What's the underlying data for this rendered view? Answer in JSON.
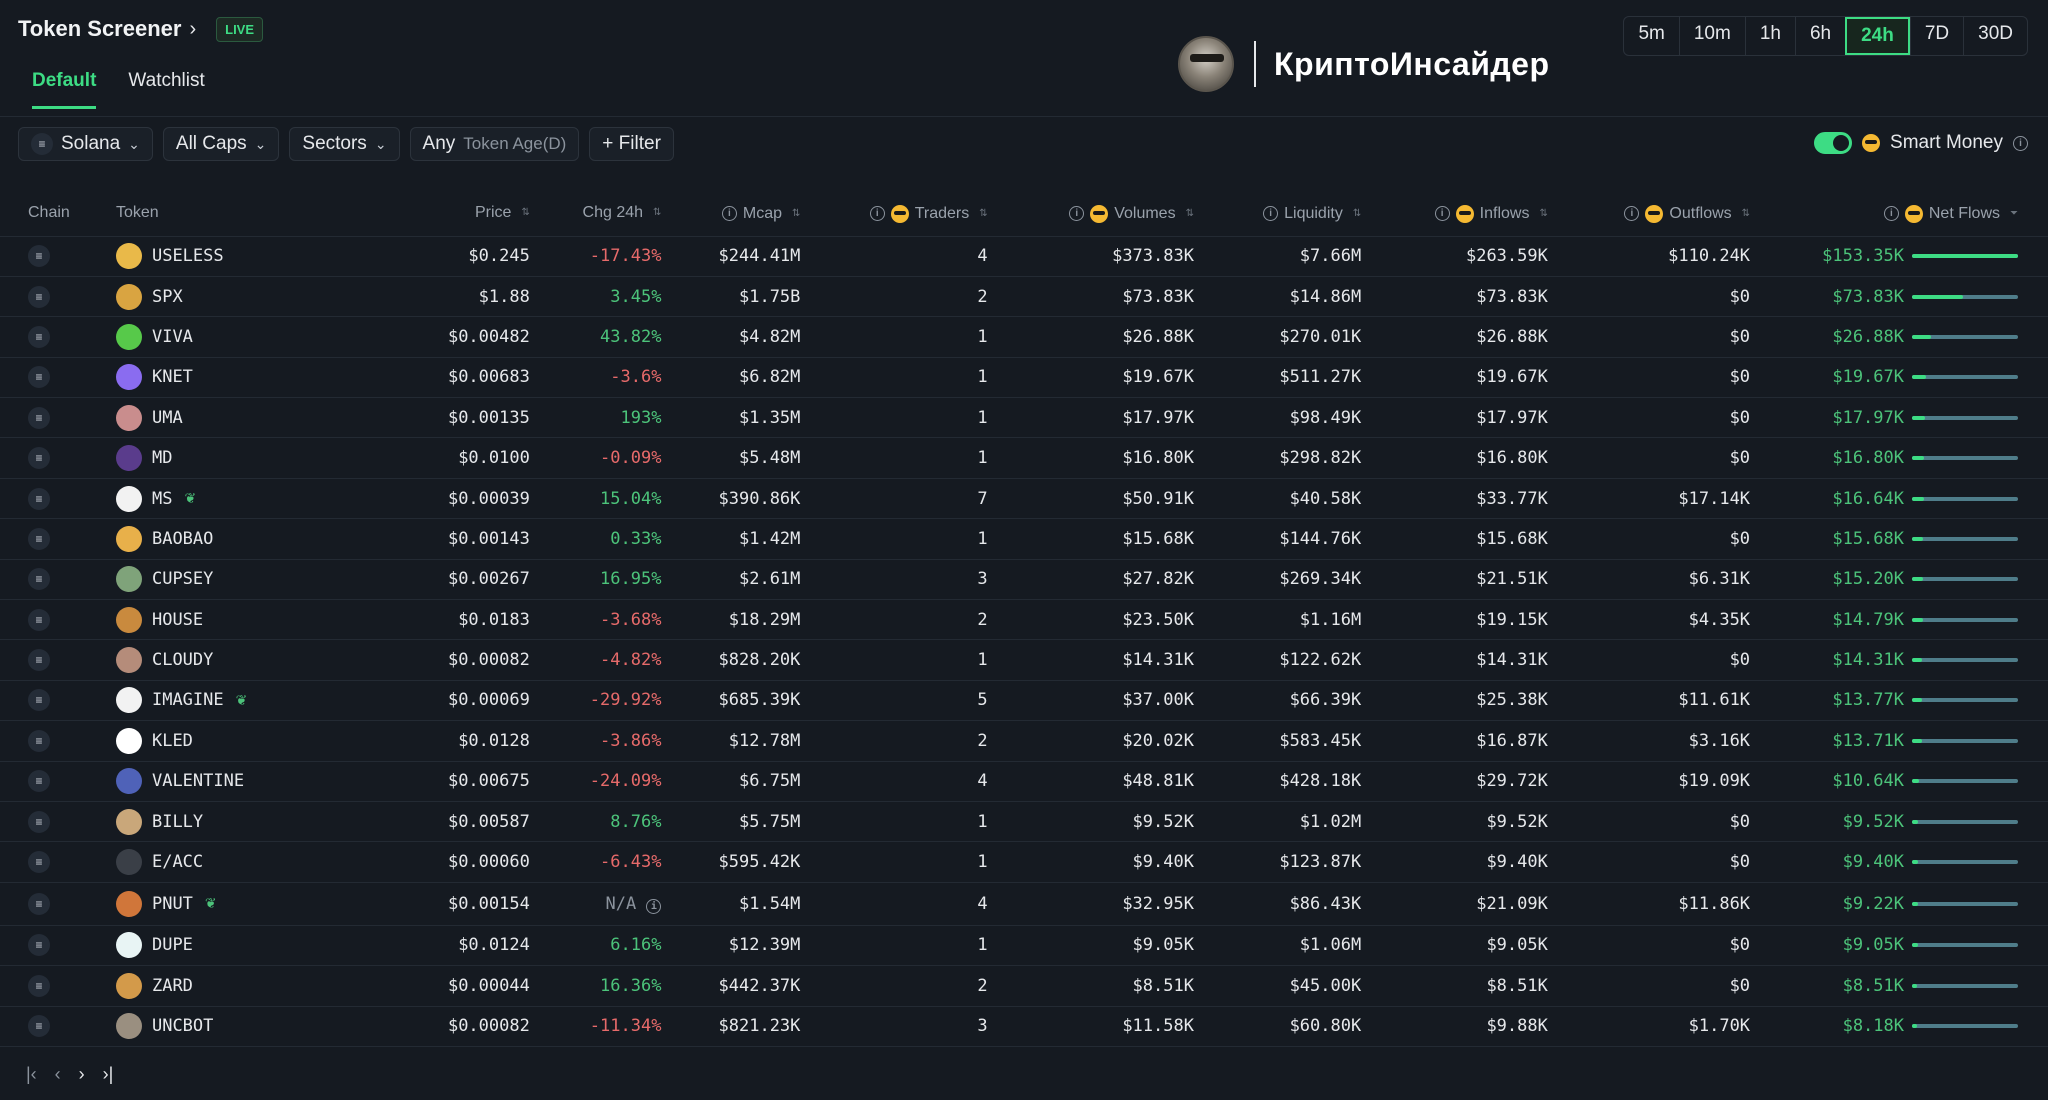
{
  "header": {
    "title": "Token Screener",
    "live_badge": "LIVE",
    "tabs": [
      "Default",
      "Watchlist"
    ],
    "brand": "КриптоИнсайдер"
  },
  "timeframes": [
    "5m",
    "10m",
    "1h",
    "6h",
    "24h",
    "7D",
    "30D"
  ],
  "active_timeframe": "24h",
  "filters": {
    "chain": "Solana",
    "caps": "All Caps",
    "sectors": "Sectors",
    "age_value": "Any",
    "age_label": "Token Age(D)",
    "filter": "+ Filter"
  },
  "smart_money": {
    "label": "Smart Money",
    "enabled": true
  },
  "columns": {
    "chain": "Chain",
    "token": "Token",
    "price": "Price",
    "chg": "Chg 24h",
    "mcap": "Mcap",
    "traders": "Traders",
    "volumes": "Volumes",
    "liquidity": "Liquidity",
    "inflows": "Inflows",
    "outflows": "Outflows",
    "net": "Net Flows"
  },
  "rows": [
    {
      "token": "USELESS",
      "price": "$0.245",
      "chg": "-17.43%",
      "mcap": "$244.41M",
      "traders": "4",
      "volumes": "$373.83K",
      "liquidity": "$7.66M",
      "inflows": "$263.59K",
      "outflows": "$110.24K",
      "net": "$153.35K",
      "net_frac": 1.0,
      "icon_color": "#e9b949",
      "sprout": false
    },
    {
      "token": "SPX",
      "price": "$1.88",
      "chg": "3.45%",
      "mcap": "$1.75B",
      "traders": "2",
      "volumes": "$73.83K",
      "liquidity": "$14.86M",
      "inflows": "$73.83K",
      "outflows": "$0",
      "net": "$73.83K",
      "net_frac": 0.48,
      "icon_color": "#d9a441",
      "sprout": false
    },
    {
      "token": "VIVA",
      "price": "$0.00482",
      "chg": "43.82%",
      "mcap": "$4.82M",
      "traders": "1",
      "volumes": "$26.88K",
      "liquidity": "$270.01K",
      "inflows": "$26.88K",
      "outflows": "$0",
      "net": "$26.88K",
      "net_frac": 0.18,
      "icon_color": "#57c94a",
      "sprout": false
    },
    {
      "token": "KNET",
      "price": "$0.00683",
      "chg": "-3.6%",
      "mcap": "$6.82M",
      "traders": "1",
      "volumes": "$19.67K",
      "liquidity": "$511.27K",
      "inflows": "$19.67K",
      "outflows": "$0",
      "net": "$19.67K",
      "net_frac": 0.13,
      "icon_color": "#8a6cf0",
      "sprout": false
    },
    {
      "token": "UMA",
      "price": "$0.00135",
      "chg": "193%",
      "mcap": "$1.35M",
      "traders": "1",
      "volumes": "$17.97K",
      "liquidity": "$98.49K",
      "inflows": "$17.97K",
      "outflows": "$0",
      "net": "$17.97K",
      "net_frac": 0.12,
      "icon_color": "#c98d8d",
      "sprout": false
    },
    {
      "token": "MD",
      "price": "$0.0100",
      "chg": "-0.09%",
      "mcap": "$5.48M",
      "traders": "1",
      "volumes": "$16.80K",
      "liquidity": "$298.82K",
      "inflows": "$16.80K",
      "outflows": "$0",
      "net": "$16.80K",
      "net_frac": 0.11,
      "icon_color": "#5a3c8c",
      "sprout": false
    },
    {
      "token": "MS",
      "price": "$0.00039",
      "chg": "15.04%",
      "mcap": "$390.86K",
      "traders": "7",
      "volumes": "$50.91K",
      "liquidity": "$40.58K",
      "inflows": "$33.77K",
      "outflows": "$17.14K",
      "net": "$16.64K",
      "net_frac": 0.11,
      "icon_color": "#f2f2f2",
      "sprout": true
    },
    {
      "token": "BAOBAO",
      "price": "$0.00143",
      "chg": "0.33%",
      "mcap": "$1.42M",
      "traders": "1",
      "volumes": "$15.68K",
      "liquidity": "$144.76K",
      "inflows": "$15.68K",
      "outflows": "$0",
      "net": "$15.68K",
      "net_frac": 0.1,
      "icon_color": "#e8b04a",
      "sprout": false
    },
    {
      "token": "CUPSEY",
      "price": "$0.00267",
      "chg": "16.95%",
      "mcap": "$2.61M",
      "traders": "3",
      "volumes": "$27.82K",
      "liquidity": "$269.34K",
      "inflows": "$21.51K",
      "outflows": "$6.31K",
      "net": "$15.20K",
      "net_frac": 0.1,
      "icon_color": "#7fa37a",
      "sprout": false
    },
    {
      "token": "HOUSE",
      "price": "$0.0183",
      "chg": "-3.68%",
      "mcap": "$18.29M",
      "traders": "2",
      "volumes": "$23.50K",
      "liquidity": "$1.16M",
      "inflows": "$19.15K",
      "outflows": "$4.35K",
      "net": "$14.79K",
      "net_frac": 0.1,
      "icon_color": "#c98a3e",
      "sprout": false
    },
    {
      "token": "CLOUDY",
      "price": "$0.00082",
      "chg": "-4.82%",
      "mcap": "$828.20K",
      "traders": "1",
      "volumes": "$14.31K",
      "liquidity": "$122.62K",
      "inflows": "$14.31K",
      "outflows": "$0",
      "net": "$14.31K",
      "net_frac": 0.09,
      "icon_color": "#b58c7a",
      "sprout": false
    },
    {
      "token": "IMAGINE",
      "price": "$0.00069",
      "chg": "-29.92%",
      "mcap": "$685.39K",
      "traders": "5",
      "volumes": "$37.00K",
      "liquidity": "$66.39K",
      "inflows": "$25.38K",
      "outflows": "$11.61K",
      "net": "$13.77K",
      "net_frac": 0.09,
      "icon_color": "#f2f2f2",
      "sprout": true
    },
    {
      "token": "KLED",
      "price": "$0.0128",
      "chg": "-3.86%",
      "mcap": "$12.78M",
      "traders": "2",
      "volumes": "$20.02K",
      "liquidity": "$583.45K",
      "inflows": "$16.87K",
      "outflows": "$3.16K",
      "net": "$13.71K",
      "net_frac": 0.09,
      "icon_color": "#ffffff",
      "sprout": false
    },
    {
      "token": "VALENTINE",
      "price": "$0.00675",
      "chg": "-24.09%",
      "mcap": "$6.75M",
      "traders": "4",
      "volumes": "$48.81K",
      "liquidity": "$428.18K",
      "inflows": "$29.72K",
      "outflows": "$19.09K",
      "net": "$10.64K",
      "net_frac": 0.07,
      "icon_color": "#4f62b8",
      "sprout": false
    },
    {
      "token": "BILLY",
      "price": "$0.00587",
      "chg": "8.76%",
      "mcap": "$5.75M",
      "traders": "1",
      "volumes": "$9.52K",
      "liquidity": "$1.02M",
      "inflows": "$9.52K",
      "outflows": "$0",
      "net": "$9.52K",
      "net_frac": 0.06,
      "icon_color": "#c9a77a",
      "sprout": false
    },
    {
      "token": "E/ACC",
      "price": "$0.00060",
      "chg": "-6.43%",
      "mcap": "$595.42K",
      "traders": "1",
      "volumes": "$9.40K",
      "liquidity": "$123.87K",
      "inflows": "$9.40K",
      "outflows": "$0",
      "net": "$9.40K",
      "net_frac": 0.06,
      "icon_color": "#3a3f47",
      "sprout": false
    },
    {
      "token": "PNUT",
      "price": "$0.00154",
      "chg": "N/A",
      "mcap": "$1.54M",
      "traders": "4",
      "volumes": "$32.95K",
      "liquidity": "$86.43K",
      "inflows": "$21.09K",
      "outflows": "$11.86K",
      "net": "$9.22K",
      "net_frac": 0.06,
      "icon_color": "#d0763a",
      "sprout": true
    },
    {
      "token": "DUPE",
      "price": "$0.0124",
      "chg": "6.16%",
      "mcap": "$12.39M",
      "traders": "1",
      "volumes": "$9.05K",
      "liquidity": "$1.06M",
      "inflows": "$9.05K",
      "outflows": "$0",
      "net": "$9.05K",
      "net_frac": 0.06,
      "icon_color": "#e8f4f4",
      "sprout": false
    },
    {
      "token": "ZARD",
      "price": "$0.00044",
      "chg": "16.36%",
      "mcap": "$442.37K",
      "traders": "2",
      "volumes": "$8.51K",
      "liquidity": "$45.00K",
      "inflows": "$8.51K",
      "outflows": "$0",
      "net": "$8.51K",
      "net_frac": 0.05,
      "icon_color": "#d39a4a",
      "sprout": false
    },
    {
      "token": "UNCBOT",
      "price": "$0.00082",
      "chg": "-11.34%",
      "mcap": "$821.23K",
      "traders": "3",
      "volumes": "$11.58K",
      "liquidity": "$60.80K",
      "inflows": "$9.88K",
      "outflows": "$1.70K",
      "net": "$8.18K",
      "net_frac": 0.05,
      "icon_color": "#9a8f80",
      "sprout": false
    }
  ],
  "pager": {
    "first": "|‹",
    "prev": "‹",
    "next": "›",
    "last": "›|"
  },
  "colors": {
    "accent": "#3ddc84",
    "positive": "#4cc37a",
    "negative": "#e66a6a",
    "background": "#151a21"
  }
}
